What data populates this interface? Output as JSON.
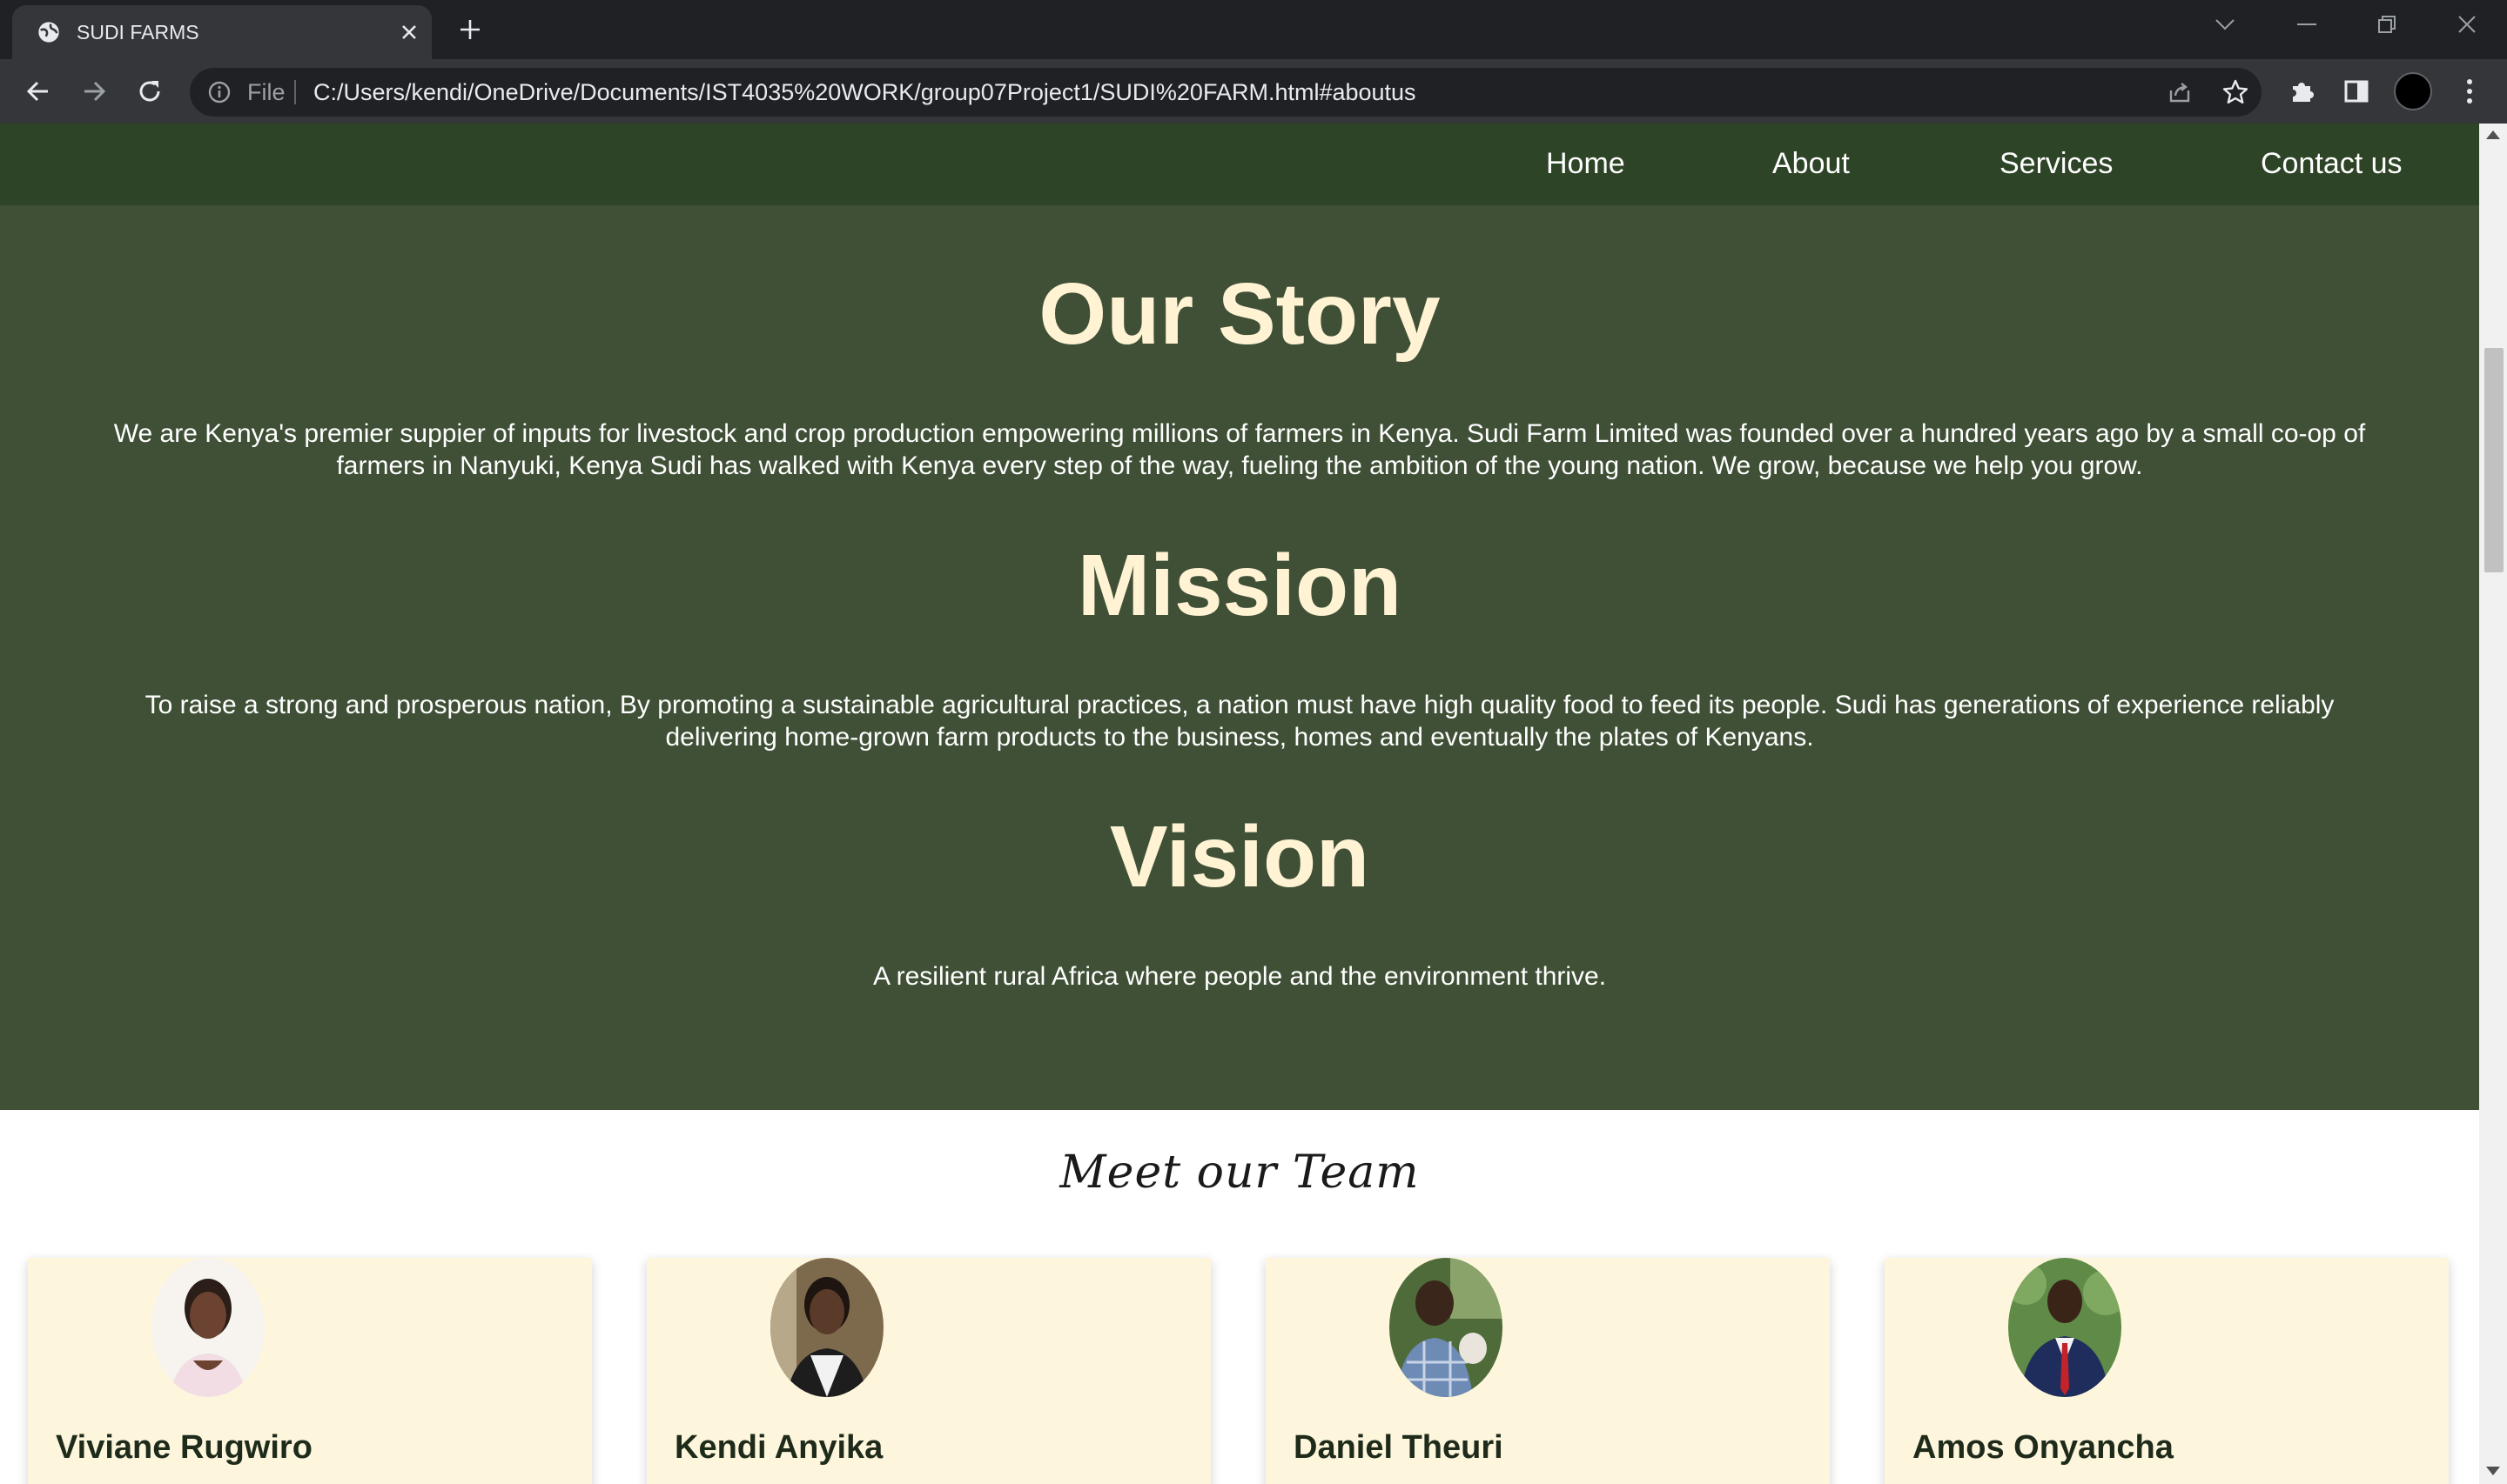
{
  "browser": {
    "tab_title": "SUDI FARMS",
    "scheme_label": "File",
    "url": "C:/Users/kendi/OneDrive/Documents/IST4035%20WORK/group07Project1/SUDI%20FARM.html#aboutus"
  },
  "nav": {
    "items": [
      "Home",
      "About",
      "Services",
      "Contact us"
    ]
  },
  "about": {
    "story_title": "Our Story",
    "story_text": "We are Kenya's premier suppier of inputs for livestock and crop production empowering millions of farmers in Kenya. Sudi Farm Limited was founded over a hundred years ago by a small co-op of farmers in Nanyuki, Kenya Sudi has walked with Kenya every step of the way, fueling the ambition of the young nation. We grow, because we help you grow.",
    "mission_title": "Mission",
    "mission_text": "To raise a strong and prosperous nation, By promoting a sustainable agricultural practices, a nation must have high quality food to feed its people. Sudi has generations of experience reliably delivering home-grown farm products to the business, homes and eventually the plates of Kenyans.",
    "vision_title": "Vision",
    "vision_text": "A resilient rural Africa where people and the environment thrive."
  },
  "team": {
    "title": "Meet our Team",
    "members": [
      {
        "name": "Viviane Rugwiro"
      },
      {
        "name": "Kendi Anyika"
      },
      {
        "name": "Daniel Theuri"
      },
      {
        "name": "Amos Onyancha"
      }
    ]
  },
  "colors": {
    "nav_bg": "#2e4427",
    "about_bg": "#3f5036",
    "heading": "#fff3d4",
    "card_bg": "#fdf6dd"
  }
}
